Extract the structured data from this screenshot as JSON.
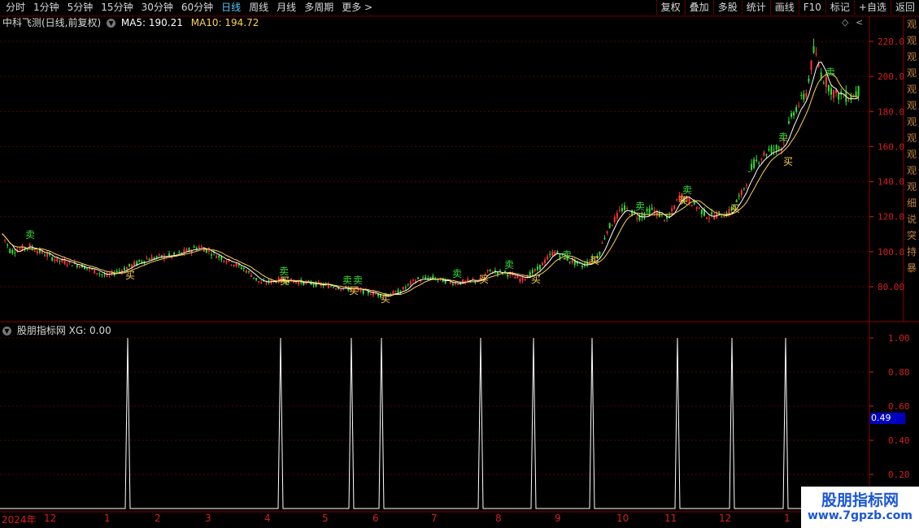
{
  "toolbar": {
    "left_items": [
      "分时",
      "1分钟",
      "5分钟",
      "15分钟",
      "30分钟",
      "60分钟",
      "日线",
      "周线",
      "月线",
      "多周期",
      "更多 >"
    ],
    "active_item": "日线",
    "right_items": [
      "复权",
      "叠加",
      "多股",
      "统计",
      "画线",
      "F10",
      "标记",
      "+自选",
      "返回"
    ]
  },
  "info": {
    "stock_name": "中科飞测(日线,前复权)",
    "ma5": "MA5: 190.21",
    "ma10": "MA10: 194.72"
  },
  "price_axis": [
    "220.0",
    "200.0",
    "180.0",
    "160.0",
    "140.0",
    "120.0",
    "100.0",
    "80.00"
  ],
  "indicator": {
    "title": "股朋指标网 XG: 0.00",
    "axis": [
      "1.00",
      "0.80",
      "0.60",
      "0.40",
      "0.20"
    ],
    "current_value": "0.49"
  },
  "date_axis": [
    "2024年",
    "12",
    "1",
    "2",
    "3",
    "4",
    "5",
    "6",
    "7",
    "8",
    "9",
    "10",
    "11",
    "12",
    "1"
  ],
  "right_column_chars": [
    "观",
    "观",
    "观",
    "观",
    "观",
    "观",
    "观",
    "观",
    "观",
    "观",
    "观",
    "细",
    "说",
    "突",
    "持",
    "暴"
  ],
  "watermark": {
    "line1": "股朋指标网",
    "line2": "www.7gpzb.com"
  },
  "signals": {
    "buy": "买",
    "sell": "卖"
  },
  "colors": {
    "up": "#ff3333",
    "down": "#33dd33",
    "ma5": "#ffffff",
    "ma10": "#ffd24d",
    "axis_text": "#d02020",
    "grid": "#5a0000"
  },
  "chart_data": {
    "type": "candlestick",
    "price_range": [
      65,
      230
    ],
    "ma_lines": [
      "MA5",
      "MA10"
    ],
    "indicator_spikes_value": 1.0,
    "indicator_range": [
      0,
      1.1
    ]
  }
}
